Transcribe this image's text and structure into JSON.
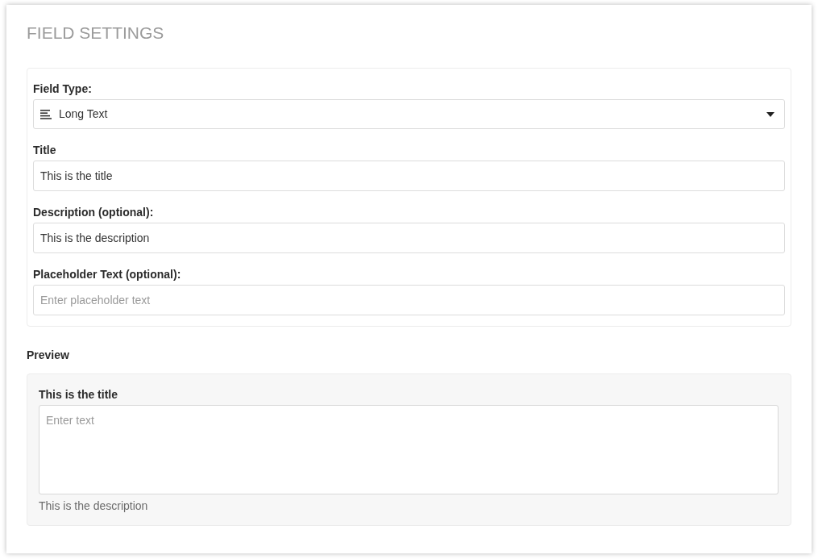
{
  "heading": "FIELD SETTINGS",
  "settings": {
    "field_type": {
      "label": "Field Type:",
      "value": "Long Text"
    },
    "fields": [
      {
        "label": "Title",
        "value": "This is the title"
      },
      {
        "label": "Description (optional):",
        "value": "This is the description"
      },
      {
        "label": "Placeholder Text (optional):",
        "placeholder": "Enter placeholder text"
      }
    ]
  },
  "preview": {
    "heading": "Preview",
    "field": {
      "label": "This is the title",
      "placeholder": "Enter text",
      "help": "This is the description"
    }
  }
}
